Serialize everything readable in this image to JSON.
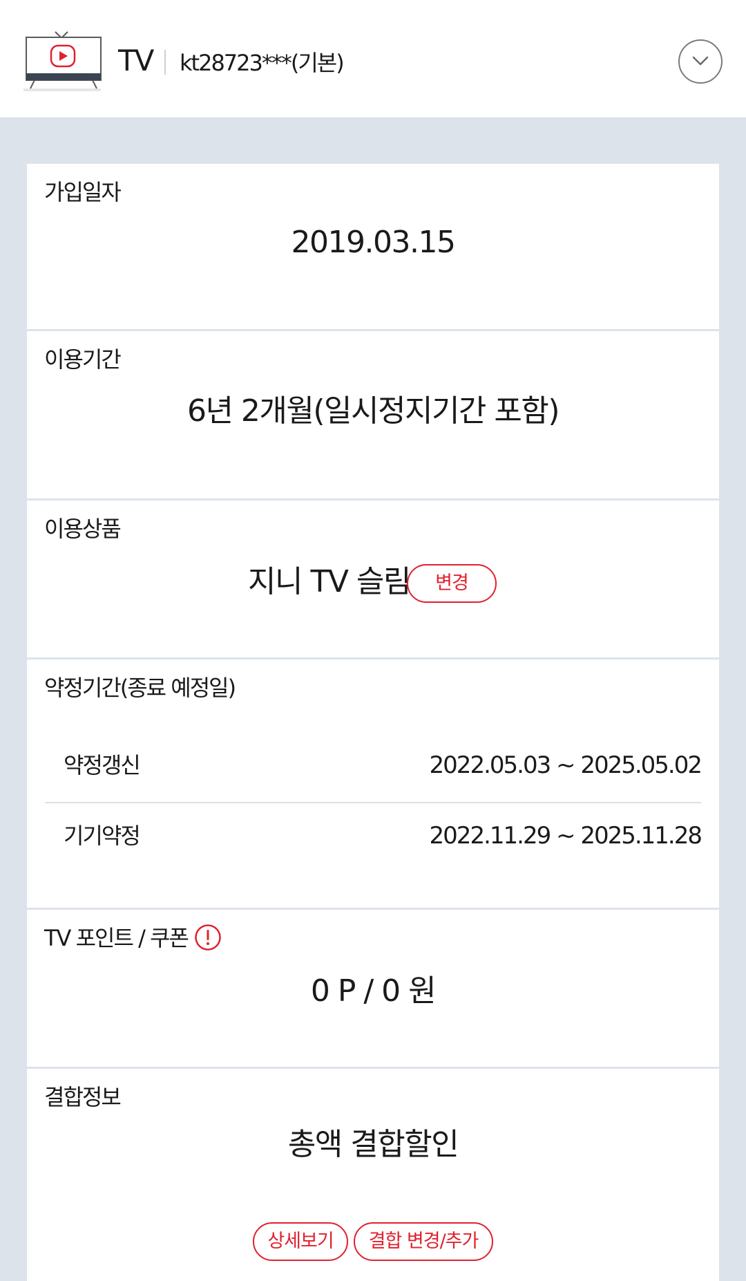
{
  "header": {
    "service_name": "TV",
    "account_id": "kt28723***(기본)"
  },
  "colors": {
    "accent_red": "#e0212e",
    "page_bg": "#dde3ea",
    "card_bg": "#ffffff",
    "tv_screen_play": "#e0212e"
  },
  "sections": {
    "join_date": {
      "label": "가입일자",
      "value": "2019.03.15"
    },
    "usage_period": {
      "label": "이용기간",
      "value": "6년 2개월(일시정지기간 포함)"
    },
    "product": {
      "label": "이용상품",
      "value": "지니 TV 슬림",
      "change_button": "변경"
    },
    "contract": {
      "label": "약정기간(종료 예정일)",
      "rows": [
        {
          "name": "약정갱신",
          "period": "2022.05.03 ~ 2025.05.02"
        },
        {
          "name": "기기약정",
          "period": "2022.11.29 ~ 2025.11.28"
        }
      ]
    },
    "points": {
      "label": "TV 포인트 / 쿠폰",
      "value": "0 P / 0 원"
    },
    "bundle": {
      "label": "결합정보",
      "value": "총액 결합할인",
      "detail_button": "상세보기",
      "change_button": "결합 변경/추가"
    }
  },
  "icons": {
    "tv": "tv-play-icon",
    "dropdown": "chevron-down-icon",
    "info": "exclamation-info-icon"
  }
}
